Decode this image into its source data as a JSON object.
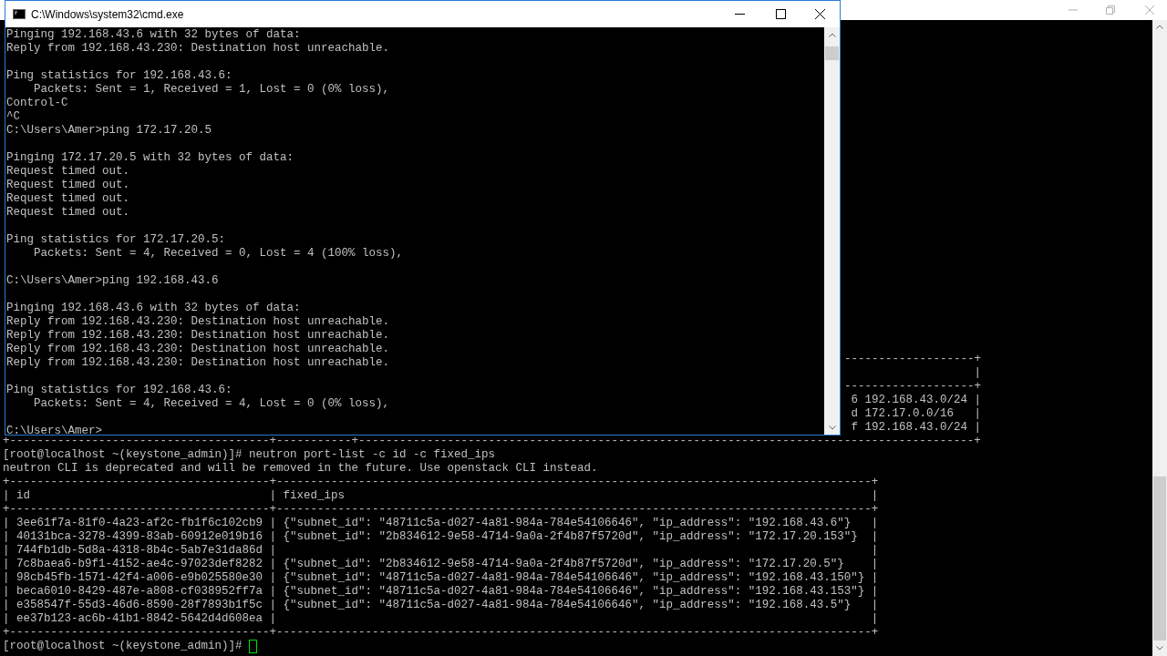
{
  "background_terminal": {
    "lines": [
      {
        "kind": "partial",
        "text": "-------------------+"
      },
      {
        "kind": "partial",
        "text": "|"
      },
      {
        "kind": "partial",
        "text": "-------------------+"
      },
      {
        "kind": "partial",
        "text": "6 192.168.43.0/24 |"
      },
      {
        "kind": "partial",
        "text": "d 172.17.0.0/16   |"
      },
      {
        "kind": "partial",
        "text": "f 192.168.43.0/24 |"
      },
      {
        "kind": "full",
        "text": "+--------------------------------------+-----------+------------------------------------------------------------------------------------------+"
      },
      {
        "kind": "full",
        "text": "[root@localhost ~(keystone_admin)]# neutron port-list -c id -c fixed_ips"
      },
      {
        "kind": "full",
        "text": "neutron CLI is deprecated and will be removed in the future. Use openstack CLI instead."
      },
      {
        "kind": "full",
        "text": "+--------------------------------------+---------------------------------------------------------------------------------------+"
      },
      {
        "kind": "full",
        "text": "| id                                   | fixed_ips                                                                             |"
      },
      {
        "kind": "full",
        "text": "+--------------------------------------+---------------------------------------------------------------------------------------+"
      },
      {
        "kind": "full",
        "text": "| 3ee61f7a-81f0-4a23-af2c-fb1f6c102cb9 | {\"subnet_id\": \"48711c5a-d027-4a81-984a-784e54106646\", \"ip_address\": \"192.168.43.6\"}   |"
      },
      {
        "kind": "full",
        "text": "| 40131bca-3278-4399-83ab-60912e019b16 | {\"subnet_id\": \"2b834612-9e58-4714-9a0a-2f4b87f5720d\", \"ip_address\": \"172.17.20.153\"}  |"
      },
      {
        "kind": "full",
        "text": "| 744fb1db-5d8a-4318-8b4c-5ab7e31da86d |                                                                                       |"
      },
      {
        "kind": "full",
        "text": "| 7c8baea6-b9f1-4152-ae4c-97023def8282 | {\"subnet_id\": \"2b834612-9e58-4714-9a0a-2f4b87f5720d\", \"ip_address\": \"172.17.20.5\"}    |"
      },
      {
        "kind": "full",
        "text": "| 98cb45fb-1571-42f4-a006-e9b025580e30 | {\"subnet_id\": \"48711c5a-d027-4a81-984a-784e54106646\", \"ip_address\": \"192.168.43.150\"} |"
      },
      {
        "kind": "full",
        "text": "| beca6010-8429-487e-a808-cf038952ff7a | {\"subnet_id\": \"48711c5a-d027-4a81-984a-784e54106646\", \"ip_address\": \"192.168.43.153\"} |"
      },
      {
        "kind": "full",
        "text": "| e358547f-55d3-46d6-8590-28f7893b1f5c | {\"subnet_id\": \"48711c5a-d027-4a81-984a-784e54106646\", \"ip_address\": \"192.168.43.5\"}   |"
      },
      {
        "kind": "full",
        "text": "| ee37b123-ac6b-41b1-8842-5642d4d608ea |                                                                                       |"
      },
      {
        "kind": "full",
        "text": "+--------------------------------------+---------------------------------------------------------------------------------------+"
      },
      {
        "kind": "prompt",
        "text": "[root@localhost ~(keystone_admin)]#"
      }
    ]
  },
  "cmd_window": {
    "title": "C:\\Windows\\system32\\cmd.exe",
    "blocks": [
      [
        "Pinging 192.168.43.6 with 32 bytes of data:",
        "Reply from 192.168.43.230: Destination host unreachable."
      ],
      [
        "Ping statistics for 192.168.43.6:",
        "    Packets: Sent = 1, Received = 1, Lost = 0 (0% loss),",
        "Control-C",
        "^C",
        "C:\\Users\\Amer>ping 172.17.20.5"
      ],
      [
        "Pinging 172.17.20.5 with 32 bytes of data:",
        "Request timed out.",
        "Request timed out.",
        "Request timed out.",
        "Request timed out."
      ],
      [
        "Ping statistics for 172.17.20.5:",
        "    Packets: Sent = 4, Received = 0, Lost = 4 (100% loss),"
      ],
      [
        "C:\\Users\\Amer>ping 192.168.43.6"
      ],
      [
        "Pinging 192.168.43.6 with 32 bytes of data:",
        "Reply from 192.168.43.230: Destination host unreachable.",
        "Reply from 192.168.43.230: Destination host unreachable.",
        "Reply from 192.168.43.230: Destination host unreachable.",
        "Reply from 192.168.43.230: Destination host unreachable."
      ],
      [
        "Ping statistics for 192.168.43.6:",
        "    Packets: Sent = 4, Received = 4, Lost = 0 (0% loss),"
      ],
      [
        "C:\\Users\\Amer>"
      ]
    ]
  }
}
